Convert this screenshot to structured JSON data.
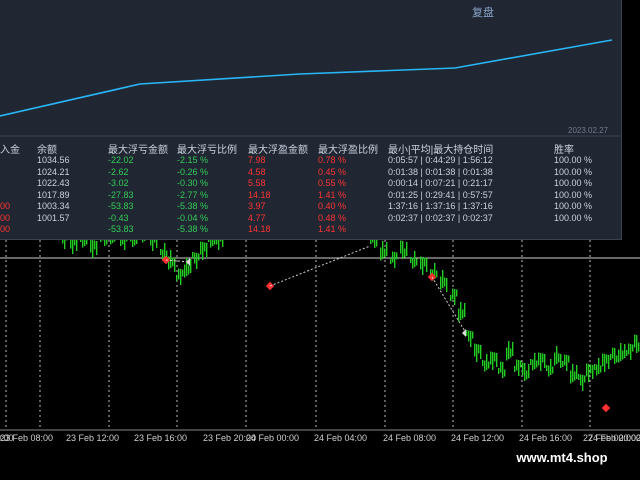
{
  "colors": {
    "background": "#000000",
    "candle_up": "#22cc22",
    "panel": "#202733",
    "curve": "#29b6f6",
    "loss": "#33cc55",
    "profit": "#ff3333"
  },
  "report": {
    "title_fragment": "复盘",
    "date_label": "2023.02.27",
    "headers": [
      "入金",
      "余额",
      "最大浮亏金额",
      "最大浮亏比例",
      "最大浮盈金额",
      "最大浮盈比例",
      "最小|平均|最大持仓时间",
      "胜率"
    ],
    "rows": [
      [
        "",
        "1034.56",
        "-22.02",
        "-2.15 %",
        "7.98",
        "0.78 %",
        "0:05:57 | 0:44:29 | 1:56:12",
        "100.00 %"
      ],
      [
        "",
        "1024.21",
        "-2.62",
        "-0.26 %",
        "4.58",
        "0.45 %",
        "0:01:38 | 0:01:38 | 0:01:38",
        "100.00 %"
      ],
      [
        "",
        "1022.43",
        "-3.02",
        "-0.30 %",
        "5.58",
        "0.55 %",
        "0:00:14 | 0:07:21 | 0:21:17",
        "100.00 %"
      ],
      [
        "",
        "1017.89",
        "-27.83",
        "-2.77 %",
        "14.18",
        "1.41 %",
        "0:01:25 | 0:29:41 | 0:57:57",
        "100.00 %"
      ],
      [
        "00",
        "1003.34",
        "-53.83",
        "-5.38 %",
        "3.97",
        "0.40 %",
        "1:37:16 | 1:37:16 | 1:37:16",
        "100.00 %"
      ],
      [
        "00",
        "1001.57",
        "-0.43",
        "-0.04 %",
        "4.77",
        "0.48 %",
        "0:02:37 | 0:02:37 | 0:02:37",
        "100.00 %"
      ],
      [
        "00",
        "",
        "-53.83",
        "-5.38 %",
        "14.18",
        "1.41 %",
        "",
        ""
      ]
    ]
  },
  "xaxis": {
    "labels": [
      "0:00",
      "23 Feb 08:00",
      "23 Feb 12:00",
      "23 Feb 16:00",
      "23 Feb 20:00",
      "24 Feb 00:00",
      "24 Feb 04:00",
      "24 Feb 08:00",
      "24 Feb 12:00",
      "24 Feb 16:00",
      "24 Feb 20:00",
      "27 Feb 00:00",
      "2"
    ]
  },
  "watermark": "www.mt4.shop"
}
